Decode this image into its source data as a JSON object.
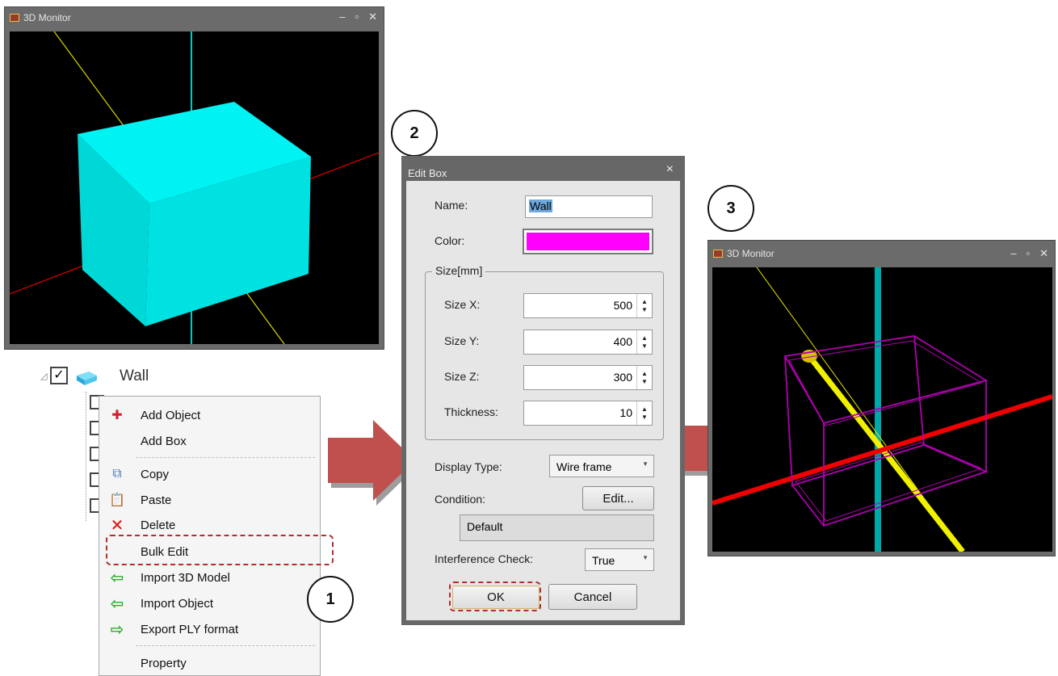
{
  "monitor1": {
    "title": "3D Monitor",
    "controls": [
      "–",
      "▫",
      "✕"
    ]
  },
  "monitor3": {
    "title": "3D Monitor",
    "controls": [
      "–",
      "▫",
      "✕"
    ]
  },
  "tree": {
    "root_label": "Wall"
  },
  "context_menu": {
    "items": [
      {
        "label": "Add Object",
        "icon": "add-object-icon"
      },
      {
        "label": "Add Box",
        "icon": ""
      },
      {
        "label": "Copy",
        "icon": "copy-icon"
      },
      {
        "label": "Paste",
        "icon": "paste-icon"
      },
      {
        "label": "Delete",
        "icon": "delete-icon"
      },
      {
        "label": "Bulk Edit",
        "icon": ""
      },
      {
        "label": "Import 3D Model",
        "icon": "import-arrow-icon"
      },
      {
        "label": "Import Object",
        "icon": "import-arrow-icon"
      },
      {
        "label": "Export PLY format",
        "icon": "export-arrow-icon"
      },
      {
        "label": "Property",
        "icon": ""
      }
    ]
  },
  "dialog": {
    "title": "Edit Box",
    "close": "×",
    "name_label": "Name:",
    "name_value": "Wall",
    "color_label": "Color:",
    "color_value": "#ff00ff",
    "size_group": "Size[mm]",
    "size_x_label": "Size X:",
    "size_x": "500",
    "size_y_label": "Size Y:",
    "size_y": "400",
    "size_z_label": "Size Z:",
    "size_z": "300",
    "thickness_label": "Thickness:",
    "thickness": "10",
    "display_type_label": "Display Type:",
    "display_type": "Wire frame",
    "condition_label": "Condition:",
    "condition_edit": "Edit...",
    "condition_value": "Default",
    "interference_label": "Interference Check:",
    "interference_value": "True",
    "ok": "OK",
    "cancel": "Cancel"
  },
  "steps": [
    "1",
    "2",
    "3"
  ],
  "colors": {
    "box_cyan": "#00e8e8",
    "arrow_red": "#c0504d",
    "highlight_dash": "#b03030",
    "wire_magenta": "#b000b0"
  }
}
